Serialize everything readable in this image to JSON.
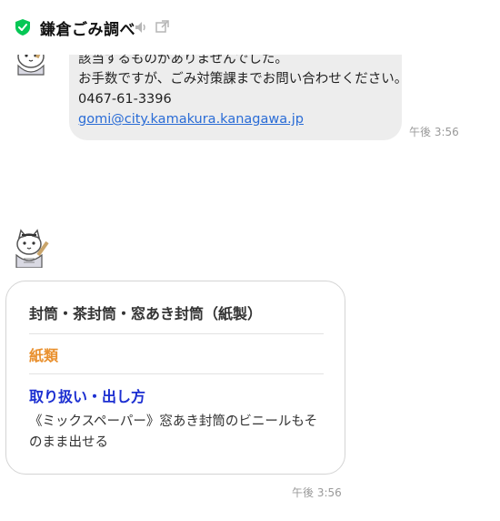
{
  "header": {
    "title": "鎌倉ごみ調べ",
    "brand_color": "#06c755"
  },
  "messages": {
    "first": {
      "line1": "該当するものがありませんでした。",
      "line2": "お手数ですが、ごみ対策課までお問い合わせください。",
      "phone": "0467-61-3396",
      "email": "gomi@city.kamakura.kanagawa.jp",
      "time": "午後 3:56"
    },
    "card": {
      "item_name": "封筒・茶封筒・窓あき封筒（紙製）",
      "category": "紙類",
      "handling_heading": "取り扱い・出し方",
      "handling_text": "《ミックスペーパー》窓あき封筒のビニールもそのまま出せる",
      "time": "午後 3:56",
      "category_color": "#e9902e",
      "heading_color": "#1c2fd1"
    }
  }
}
